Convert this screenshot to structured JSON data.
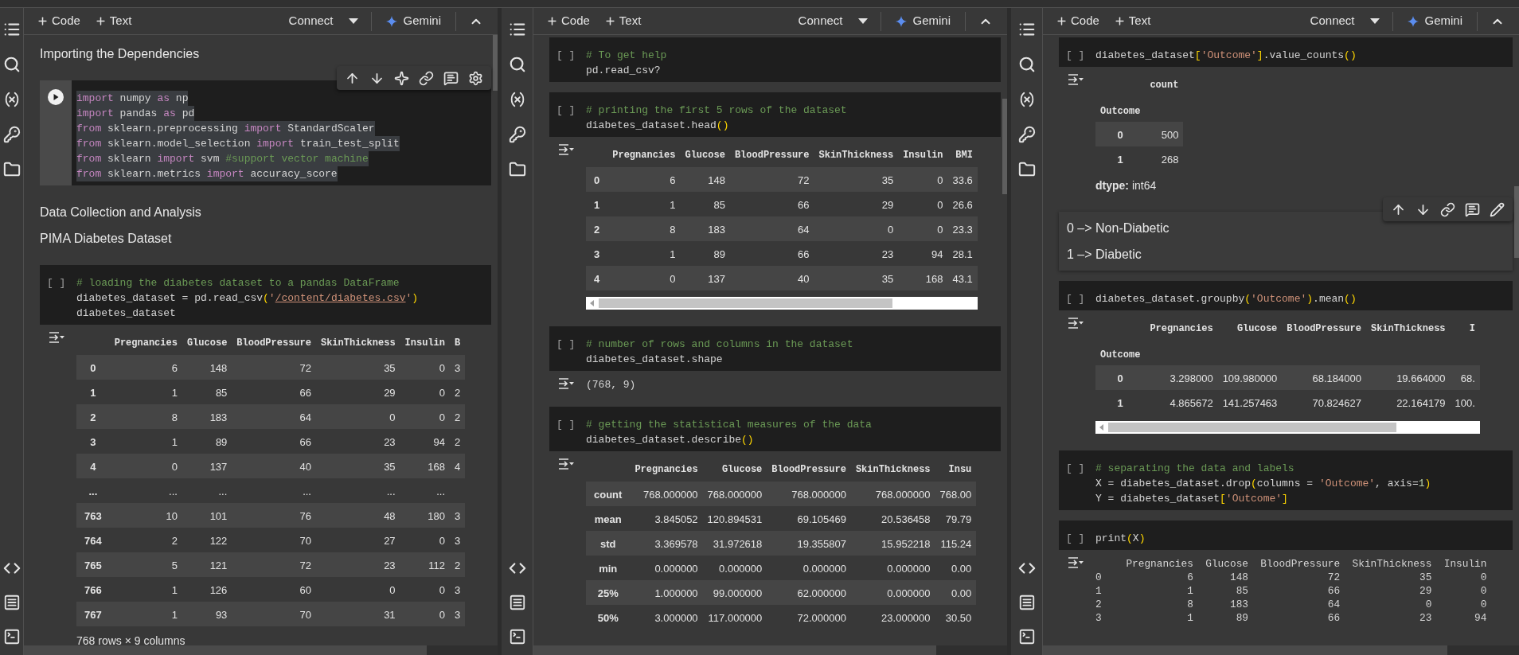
{
  "panels": [
    {
      "toolbar": {
        "add_code": "Code",
        "add_text": "Text",
        "connect": "Connect",
        "gemini": "Gemini"
      },
      "cells": [
        {
          "kind": "markdown",
          "focused": false,
          "lines": [
            "Importing the Dependencies"
          ]
        },
        {
          "kind": "code",
          "focused": true,
          "toolbar": [
            {
              "kind": "up"
            },
            {
              "kind": "down"
            },
            {
              "kind": "sparkle"
            },
            {
              "kind": "link"
            },
            {
              "kind": "comment"
            },
            {
              "kind": "settings"
            }
          ],
          "lines": [
            [
              {
                "kind": "kw",
                "text": "import"
              },
              {
                "kind": "plain",
                "text": " numpy "
              },
              {
                "kind": "kw",
                "text": "as"
              },
              {
                "kind": "plain",
                "text": " np"
              }
            ],
            [
              {
                "kind": "kw",
                "text": "import"
              },
              {
                "kind": "plain",
                "text": " pandas "
              },
              {
                "kind": "kw",
                "text": "as"
              },
              {
                "kind": "plain",
                "text": " pd"
              }
            ],
            [
              {
                "kind": "kw",
                "text": "from"
              },
              {
                "kind": "plain",
                "text": " sklearn.preprocessing "
              },
              {
                "kind": "kw",
                "text": "import"
              },
              {
                "kind": "plain",
                "text": " StandardScaler"
              }
            ],
            [
              {
                "kind": "kw",
                "text": "from"
              },
              {
                "kind": "plain",
                "text": " sklearn.model_selection "
              },
              {
                "kind": "kw",
                "text": "import"
              },
              {
                "kind": "plain",
                "text": " train_test_split"
              }
            ],
            [
              {
                "kind": "kw",
                "text": "from"
              },
              {
                "kind": "plain",
                "text": " sklearn "
              },
              {
                "kind": "kw",
                "text": "import"
              },
              {
                "kind": "plain",
                "text": " svm "
              },
              {
                "kind": "com",
                "text": "#support vector machine"
              }
            ],
            [
              {
                "kind": "kw",
                "text": "from"
              },
              {
                "kind": "plain",
                "text": " sklearn.metrics "
              },
              {
                "kind": "kw",
                "text": "import"
              },
              {
                "kind": "plain",
                "text": " accuracy_score"
              }
            ]
          ]
        },
        {
          "kind": "markdown",
          "focused": false,
          "lines": [
            "Data Collection and Analysis",
            "PIMA Diabetes Dataset"
          ]
        },
        {
          "kind": "code",
          "focused": false,
          "prompt": "[ ]",
          "lines": [
            [
              {
                "kind": "com",
                "text": "# loading the diabetes dataset to a pandas DataFrame"
              }
            ],
            [
              {
                "kind": "plain",
                "text": "diabetes_dataset = pd.read_csv"
              },
              {
                "kind": "paren",
                "text": "("
              },
              {
                "kind": "str",
                "text": "'"
              },
              {
                "kind": "path",
                "text": "/content/diabetes.csv"
              },
              {
                "kind": "str",
                "text": "'"
              },
              {
                "kind": "paren",
                "text": ")"
              }
            ],
            [
              {
                "kind": "plain",
                "text": "diabetes_dataset"
              }
            ]
          ],
          "outputs": [
            {
              "kind": "table",
              "columns": [
                "Pregnancies",
                "Glucose",
                "BloodPressure",
                "SkinThickness",
                "Insulin",
                "B"
              ],
              "rows": [
                {
                  "index": "0",
                  "values": [
                    "6",
                    "148",
                    "72",
                    "35",
                    "0",
                    "3"
                  ]
                },
                {
                  "index": "1",
                  "values": [
                    "1",
                    "85",
                    "66",
                    "29",
                    "0",
                    "2"
                  ]
                },
                {
                  "index": "2",
                  "values": [
                    "8",
                    "183",
                    "64",
                    "0",
                    "0",
                    "2"
                  ]
                },
                {
                  "index": "3",
                  "values": [
                    "1",
                    "89",
                    "66",
                    "23",
                    "94",
                    "2"
                  ]
                },
                {
                  "index": "4",
                  "values": [
                    "0",
                    "137",
                    "40",
                    "35",
                    "168",
                    "4"
                  ]
                },
                {
                  "index": "...",
                  "values": [
                    "...",
                    "...",
                    "...",
                    "...",
                    "..."
                  ]
                },
                {
                  "index": "763",
                  "values": [
                    "10",
                    "101",
                    "76",
                    "48",
                    "180",
                    "3"
                  ]
                },
                {
                  "index": "764",
                  "values": [
                    "2",
                    "122",
                    "70",
                    "27",
                    "0",
                    "3"
                  ]
                },
                {
                  "index": "765",
                  "values": [
                    "5",
                    "121",
                    "72",
                    "23",
                    "112",
                    "2"
                  ]
                },
                {
                  "index": "766",
                  "values": [
                    "1",
                    "126",
                    "60",
                    "0",
                    "0",
                    "3"
                  ]
                },
                {
                  "index": "767",
                  "values": [
                    "1",
                    "93",
                    "70",
                    "31",
                    "0",
                    "3"
                  ]
                }
              ],
              "note": "768 rows × 9 columns"
            }
          ]
        }
      ]
    },
    {
      "toolbar": {
        "add_code": "Code",
        "add_text": "Text",
        "connect": "Connect",
        "gemini": "Gemini"
      },
      "cells": [
        {
          "kind": "code",
          "focused": false,
          "prompt": "[ ]",
          "lines": [
            [
              {
                "kind": "com",
                "text": "# To get help"
              }
            ],
            [
              {
                "kind": "plain",
                "text": "pd.read_csv?"
              }
            ]
          ]
        },
        {
          "kind": "code",
          "focused": false,
          "prompt": "[ ]",
          "lines": [
            [
              {
                "kind": "com",
                "text": "# printing the first 5 rows of the dataset"
              }
            ],
            [
              {
                "kind": "plain",
                "text": "diabetes_dataset.head"
              },
              {
                "kind": "paren",
                "text": "()"
              }
            ]
          ],
          "outputs": [
            {
              "kind": "table",
              "hscroll": true,
              "columns": [
                "Pregnancies",
                "Glucose",
                "BloodPressure",
                "SkinThickness",
                "Insulin",
                "BMI"
              ],
              "rows": [
                {
                  "index": "0",
                  "values": [
                    "6",
                    "148",
                    "72",
                    "35",
                    "0",
                    "33.6"
                  ]
                },
                {
                  "index": "1",
                  "values": [
                    "1",
                    "85",
                    "66",
                    "29",
                    "0",
                    "26.6"
                  ]
                },
                {
                  "index": "2",
                  "values": [
                    "8",
                    "183",
                    "64",
                    "0",
                    "0",
                    "23.3"
                  ]
                },
                {
                  "index": "3",
                  "values": [
                    "1",
                    "89",
                    "66",
                    "23",
                    "94",
                    "28.1"
                  ]
                },
                {
                  "index": "4",
                  "values": [
                    "0",
                    "137",
                    "40",
                    "35",
                    "168",
                    "43.1"
                  ]
                }
              ]
            }
          ]
        },
        {
          "kind": "code",
          "focused": false,
          "prompt": "[ ]",
          "lines": [
            [
              {
                "kind": "com",
                "text": "# number of rows and columns in the dataset"
              }
            ],
            [
              {
                "kind": "plain",
                "text": "diabetes_dataset.shape"
              }
            ]
          ],
          "outputs": [
            {
              "kind": "text",
              "lines": [
                "(768, 9)"
              ]
            }
          ]
        },
        {
          "kind": "code",
          "focused": false,
          "prompt": "[ ]",
          "lines": [
            [
              {
                "kind": "com",
                "text": "# getting the statistical measures of the data"
              }
            ],
            [
              {
                "kind": "plain",
                "text": "diabetes_dataset.describe"
              },
              {
                "kind": "paren",
                "text": "()"
              }
            ]
          ],
          "outputs": [
            {
              "kind": "table",
              "columns": [
                "Pregnancies",
                "Glucose",
                "BloodPressure",
                "SkinThickness",
                "Insu"
              ],
              "rows": [
                {
                  "index": "count",
                  "values": [
                    "768.000000",
                    "768.000000",
                    "768.000000",
                    "768.000000",
                    "768.00"
                  ]
                },
                {
                  "index": "mean",
                  "values": [
                    "3.845052",
                    "120.894531",
                    "69.105469",
                    "20.536458",
                    "79.79"
                  ]
                },
                {
                  "index": "std",
                  "values": [
                    "3.369578",
                    "31.972618",
                    "19.355807",
                    "15.952218",
                    "115.24"
                  ]
                },
                {
                  "index": "min",
                  "values": [
                    "0.000000",
                    "0.000000",
                    "0.000000",
                    "0.000000",
                    "0.00"
                  ]
                },
                {
                  "index": "25%",
                  "values": [
                    "1.000000",
                    "99.000000",
                    "62.000000",
                    "0.000000",
                    "0.00"
                  ]
                },
                {
                  "index": "50%",
                  "values": [
                    "3.000000",
                    "117.000000",
                    "72.000000",
                    "23.000000",
                    "30.50"
                  ]
                }
              ]
            }
          ]
        }
      ]
    },
    {
      "toolbar": {
        "add_code": "Code",
        "add_text": "Text",
        "connect": "Connect",
        "gemini": "Gemini"
      },
      "cells": [
        {
          "kind": "code",
          "focused": false,
          "prompt": "[ ]",
          "lines": [
            [
              {
                "kind": "plain",
                "text": "diabetes_dataset"
              },
              {
                "kind": "paren",
                "text": "["
              },
              {
                "kind": "str",
                "text": "'Outcome'"
              },
              {
                "kind": "paren",
                "text": "]"
              },
              {
                "kind": "plain",
                "text": ".value_counts"
              },
              {
                "kind": "paren",
                "text": "()"
              }
            ]
          ],
          "outputs": [
            {
              "kind": "table",
              "columns": [
                "count"
              ],
              "index_name": "Outcome",
              "rows": [
                {
                  "index": "0",
                  "values": [
                    "500"
                  ]
                },
                {
                  "index": "1",
                  "values": [
                    "268"
                  ]
                }
              ],
              "note": "**dtype:** int64"
            }
          ]
        },
        {
          "kind": "markdown",
          "focused": true,
          "toolbar": [
            {
              "kind": "up"
            },
            {
              "kind": "down"
            },
            {
              "kind": "link"
            },
            {
              "kind": "comment"
            },
            {
              "kind": "edit"
            }
          ],
          "lines": [
            "0 –> Non-Diabetic",
            "1 –> Diabetic"
          ]
        },
        {
          "kind": "code",
          "focused": false,
          "prompt": "[ ]",
          "lines": [
            [
              {
                "kind": "plain",
                "text": "diabetes_dataset.groupby"
              },
              {
                "kind": "paren",
                "text": "("
              },
              {
                "kind": "str",
                "text": "'Outcome'"
              },
              {
                "kind": "paren",
                "text": ")"
              },
              {
                "kind": "plain",
                "text": ".mean"
              },
              {
                "kind": "paren",
                "text": "()"
              }
            ]
          ],
          "outputs": [
            {
              "kind": "table",
              "hscroll": true,
              "columns": [
                "Pregnancies",
                "Glucose",
                "BloodPressure",
                "SkinThickness",
                "I"
              ],
              "index_name": "Outcome",
              "rows": [
                {
                  "index": "0",
                  "values": [
                    "3.298000",
                    "109.980000",
                    "68.184000",
                    "19.664000",
                    "68."
                  ]
                },
                {
                  "index": "1",
                  "values": [
                    "4.865672",
                    "141.257463",
                    "70.824627",
                    "22.164179",
                    "100."
                  ]
                }
              ]
            }
          ]
        },
        {
          "kind": "code",
          "focused": false,
          "prompt": "[ ]",
          "lines": [
            [
              {
                "kind": "com",
                "text": "# separating the data and labels"
              }
            ],
            [
              {
                "kind": "plain",
                "text": "X = diabetes_dataset.drop"
              },
              {
                "kind": "paren",
                "text": "("
              },
              {
                "kind": "plain",
                "text": "columns = "
              },
              {
                "kind": "str",
                "text": "'Outcome'"
              },
              {
                "kind": "plain",
                "text": ", axis="
              },
              {
                "kind": "num",
                "text": "1"
              },
              {
                "kind": "paren",
                "text": ")"
              }
            ],
            [
              {
                "kind": "plain",
                "text": "Y = diabetes_dataset"
              },
              {
                "kind": "paren",
                "text": "["
              },
              {
                "kind": "str",
                "text": "'Outcome'"
              },
              {
                "kind": "paren",
                "text": "]"
              }
            ]
          ]
        },
        {
          "kind": "code",
          "focused": false,
          "prompt": "[ ]",
          "lines": [
            [
              {
                "kind": "plain",
                "text": "print"
              },
              {
                "kind": "paren",
                "text": "("
              },
              {
                "kind": "plain",
                "text": "X"
              },
              {
                "kind": "paren",
                "text": ")"
              }
            ]
          ],
          "outputs": [
            {
              "kind": "stream",
              "lines": [
                "     Pregnancies  Glucose  BloodPressure  SkinThickness  Insulin",
                "0              6      148             72             35        0",
                "1              1       85             66             29        0",
                "2              8      183             64              0        0",
                "3              1       89             66             23       94"
              ]
            }
          ]
        }
      ]
    }
  ]
}
